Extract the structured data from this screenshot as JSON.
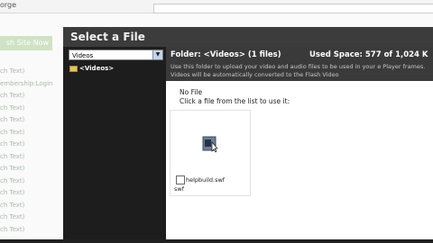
{
  "browser": {
    "title_fragment": "orge"
  },
  "background": {
    "site_button": "sh Site Now",
    "list": [
      "ch Text)",
      "embership:Login",
      "ch Text)",
      "ch Text)",
      "ch Text)",
      "ch Text)",
      "ch Text)",
      "ch Text)",
      "ch Text)",
      "ch Text)",
      "ch Text)",
      "ch Text)",
      "ch Text)",
      "ch Text)"
    ]
  },
  "dialog": {
    "title": "Select a File",
    "folder_select": {
      "value": "Videos"
    },
    "folder_tree": [
      "<Videos>"
    ],
    "header": {
      "folder_label": "Folder: <Videos>  (1 files)",
      "used_space": "Used Space: 577 of 1,024 K",
      "description": "Use this folder to upload your video and audio files to be used in your e Player frames. Videos will be automatically converted to the Flash Video"
    },
    "content": {
      "no_file": "No File",
      "click_text": "Click a file from the list to use it:",
      "files": [
        {
          "name": "helpbuild.swf",
          "ext": "swf"
        }
      ]
    }
  },
  "colors": {
    "dialog_title_bg": "#3c3c3c",
    "sidebar_bg": "#1d1d1d",
    "infobar_bg": "#3a3a3a",
    "site_button_bg": "#cfe2c3"
  }
}
